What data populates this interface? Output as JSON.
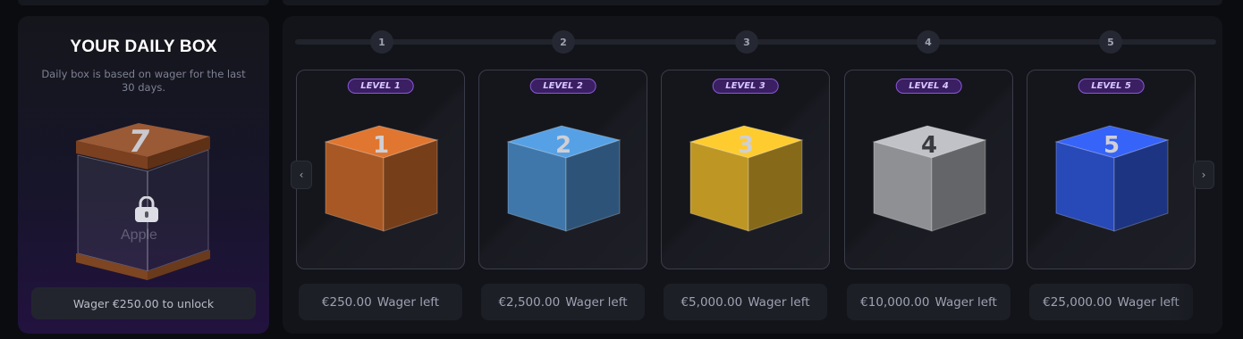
{
  "daily": {
    "title": "YOUR DAILY BOX",
    "description": "Daily box is based on wager for the last 30 days.",
    "box_number": "7",
    "unlock_button": "Wager €250.00 to unlock",
    "lock_icon": "lock-icon"
  },
  "progress": {
    "steps": [
      "1",
      "2",
      "3",
      "4",
      "5"
    ]
  },
  "levels": [
    {
      "badge": "LEVEL 1",
      "number": "1",
      "amount": "€250.00",
      "suffix": "Wager left",
      "color": "#c4672a"
    },
    {
      "badge": "LEVEL 2",
      "number": "2",
      "amount": "€2,500.00",
      "suffix": "Wager left",
      "color": "#4b8cc8"
    },
    {
      "badge": "LEVEL 3",
      "number": "3",
      "amount": "€5,000.00",
      "suffix": "Wager left",
      "color": "#e0b12a"
    },
    {
      "badge": "LEVEL 4",
      "number": "4",
      "amount": "€10,000.00",
      "suffix": "Wager left",
      "color": "#a7a9ae"
    },
    {
      "badge": "LEVEL 5",
      "number": "5",
      "amount": "€25,000.00",
      "suffix": "Wager left",
      "color": "#2f56d8"
    }
  ],
  "nav": {
    "prev_icon": "chevron-left-icon",
    "next_icon": "chevron-right-icon",
    "prev": "‹",
    "next": "›"
  }
}
